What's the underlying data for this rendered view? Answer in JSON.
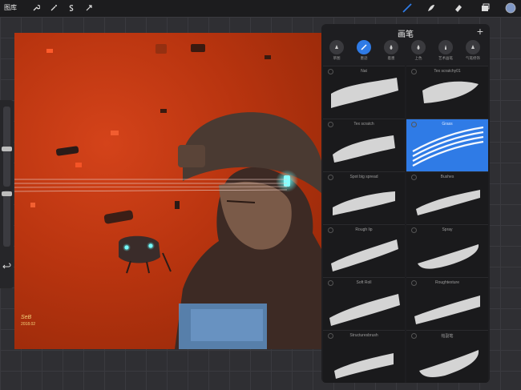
{
  "topbar": {
    "gallery_label": "图库",
    "left_tools": [
      "wrench-icon",
      "magic-wand-icon",
      "selection-s-icon",
      "transform-arrow-icon"
    ],
    "right_tools": [
      "brush-icon",
      "smudge-icon",
      "eraser-icon",
      "layers-icon",
      "color-swatch-icon"
    ],
    "accent": "#2f7be6",
    "color_swatch": "#7f97c5"
  },
  "brush_panel": {
    "title": "画笔",
    "plus": "+",
    "categories": [
      "草图",
      "墨迹",
      "着墨",
      "上色",
      "艺术画笔",
      "气笔修饰"
    ],
    "active_category_index": 1,
    "brushes": [
      "Nat",
      "Tex scratchy01",
      "Tex scratch",
      "Grass",
      "Spot big spread",
      "Bushes",
      "Rough lip",
      "Spray",
      "Soft Roll",
      "Roughtexture",
      "Structuresbrush",
      "帕副笔"
    ],
    "selected_brush_index": 3
  },
  "canvas": {
    "signature": "SeB",
    "signature_date": "2018.02"
  },
  "colors": {
    "canvas_red": "#c13c13",
    "panel_bg": "#1e1e21"
  }
}
